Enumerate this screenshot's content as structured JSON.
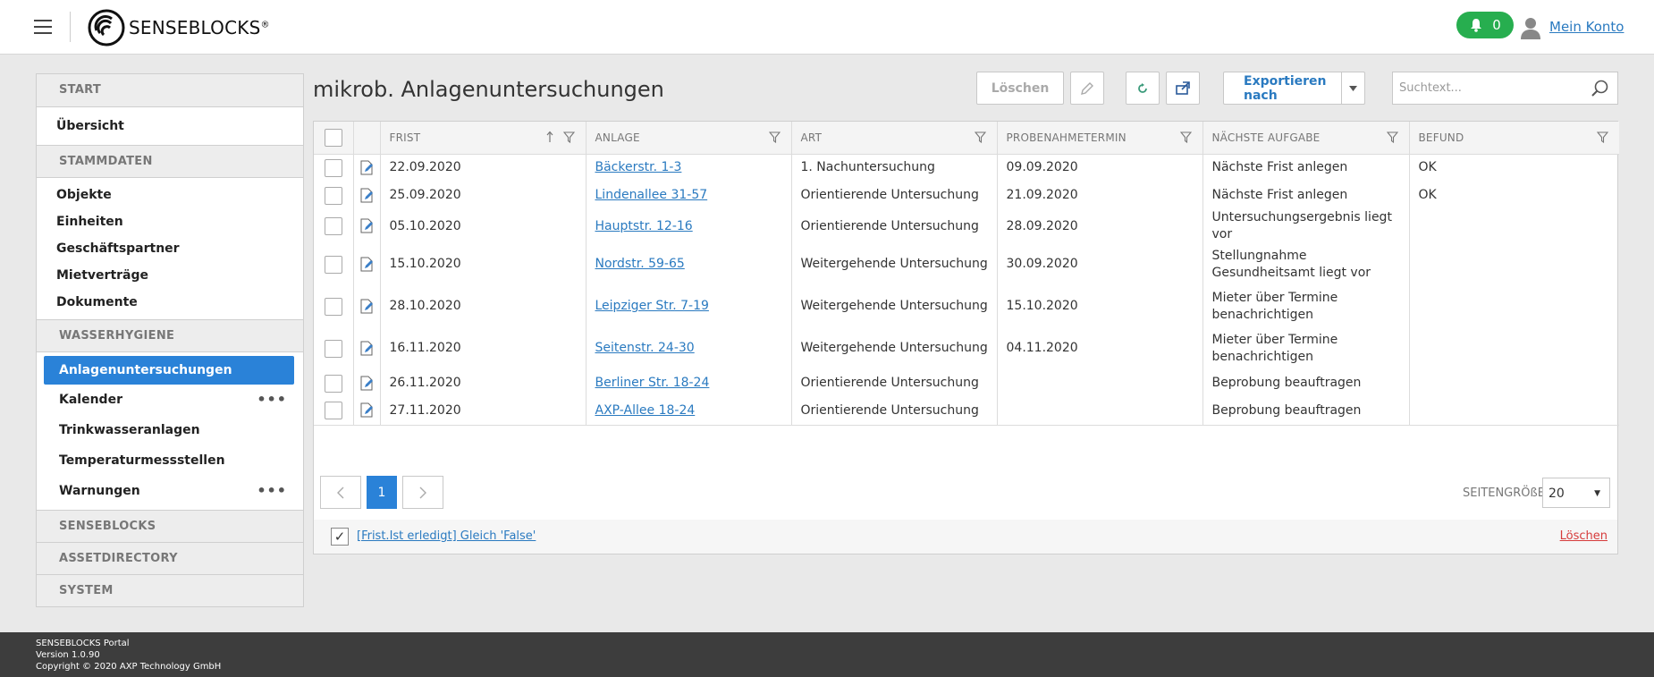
{
  "header": {
    "brand": "SENSEBLOCKS",
    "brand_mark": "®",
    "notifications": "0",
    "account_link": "Mein Konto"
  },
  "sidebar": {
    "start": "START",
    "overview": "Übersicht",
    "stammdaten": "STAMMDATEN",
    "stammdaten_items": [
      "Objekte",
      "Einheiten",
      "Geschäftspartner",
      "Mietverträge",
      "Dokumente"
    ],
    "wasserhygiene": "WASSERHYGIENE",
    "wasserhygiene_items": [
      "Anlagenuntersuchungen",
      "Kalender",
      "Trinkwasseranlagen",
      "Temperaturmessstellen",
      "Warnungen"
    ],
    "senseblocks": "SENSEBLOCKS",
    "assetdirectory": "ASSETDIRECTORY",
    "system": "SYSTEM"
  },
  "main": {
    "title": "mikrob. Anlagenuntersuchungen",
    "delete_button": "Löschen",
    "export_button": "Exportieren nach",
    "search_placeholder": "Suchtext..."
  },
  "table": {
    "columns": [
      "FRIST",
      "ANLAGE",
      "ART",
      "PROBENAHMETERMIN",
      "NÄCHSTE AUFGABE",
      "BEFUND"
    ],
    "rows": [
      {
        "frist": "22.09.2020",
        "anlage": "Bäckerstr. 1-3",
        "art": "1. Nachuntersuchung",
        "termin": "09.09.2020",
        "aufgabe": "Nächste Frist anlegen",
        "befund": "OK"
      },
      {
        "frist": "25.09.2020",
        "anlage": "Lindenallee 31-57",
        "art": "Orientierende Untersuchung",
        "termin": "21.09.2020",
        "aufgabe": "Nächste Frist anlegen",
        "befund": "OK"
      },
      {
        "frist": "05.10.2020",
        "anlage": "Hauptstr. 12-16",
        "art": "Orientierende Untersuchung",
        "termin": "28.09.2020",
        "aufgabe": "Untersuchungsergebnis liegt vor",
        "befund": ""
      },
      {
        "frist": "15.10.2020",
        "anlage": "Nordstr. 59-65",
        "art": "Weitergehende Untersuchung",
        "termin": "30.09.2020",
        "aufgabe": "Stellungnahme Gesundheitsamt liegt vor",
        "befund": ""
      },
      {
        "frist": "28.10.2020",
        "anlage": "Leipziger Str. 7-19",
        "art": "Weitergehende Untersuchung",
        "termin": "15.10.2020",
        "aufgabe": "Mieter über Termine benachrichtigen",
        "befund": ""
      },
      {
        "frist": "16.11.2020",
        "anlage": "Seitenstr. 24-30",
        "art": "Weitergehende Untersuchung",
        "termin": "04.11.2020",
        "aufgabe": "Mieter über Termine benachrichtigen",
        "befund": ""
      },
      {
        "frist": "26.11.2020",
        "anlage": "Berliner Str. 18-24",
        "art": "Orientierende Untersuchung",
        "termin": "",
        "aufgabe": "Beprobung beauftragen",
        "befund": ""
      },
      {
        "frist": "27.11.2020",
        "anlage": "AXP-Allee 18-24",
        "art": "Orientierende Untersuchung",
        "termin": "",
        "aufgabe": "Beprobung beauftragen",
        "befund": ""
      }
    ]
  },
  "pager": {
    "current_page": "1",
    "page_size_label": "SEITENGRÖßE",
    "page_size": "20"
  },
  "filter": {
    "text": "[Frist.Ist erledigt] Gleich 'False'",
    "clear": "Löschen"
  },
  "footer": {
    "line1": "SENSEBLOCKS Portal",
    "line2": "Version 1.0.90",
    "line3": "Copyright © 2020 AXP Technology GmbH"
  },
  "colors": {
    "accent": "#2a82d8",
    "link": "#2a7ac0",
    "notification": "#27ae4f",
    "danger": "#d63b3b",
    "footer": "#3d3d3d"
  }
}
